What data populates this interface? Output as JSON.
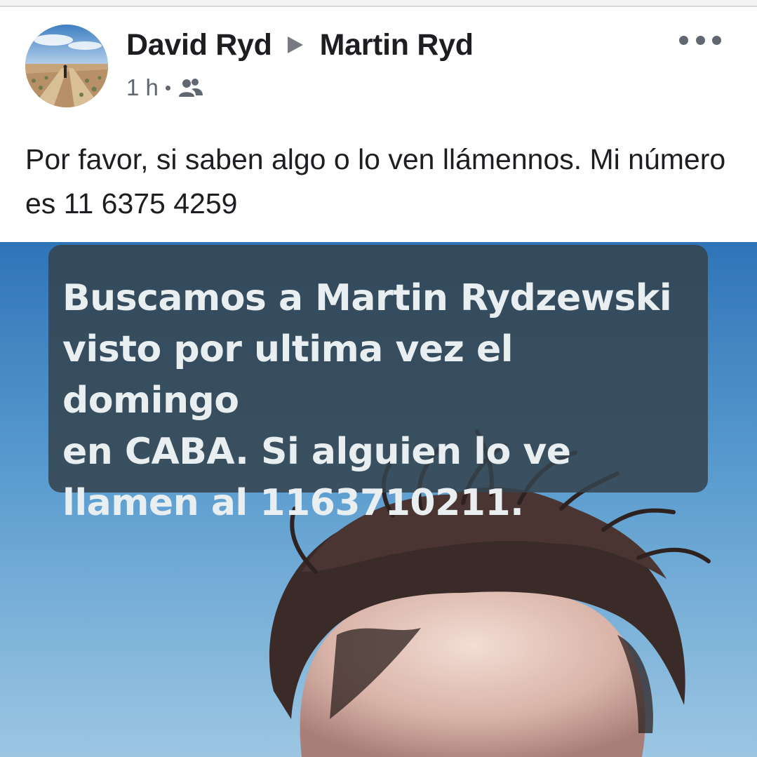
{
  "post": {
    "author": "David Ryd",
    "recipient": "Martin Ryd",
    "time": "1 h",
    "audience_icon": "friends-icon",
    "more_icon": "more-options-icon",
    "text": "Por favor, si saben algo o lo ven llámennos. Mi número es 11 6375 4259"
  },
  "photo": {
    "caption": "Buscamos a Martin Rydzewski\nvisto por ultima vez el domingo\nen CABA. Si alguien lo ve\nllamen al 1163710211."
  },
  "colors": {
    "name_text": "#1c1e21",
    "meta_text": "#606770",
    "caption_box": "#34444e",
    "caption_text": "#e9eef0",
    "sky": "#5a9ccf"
  }
}
